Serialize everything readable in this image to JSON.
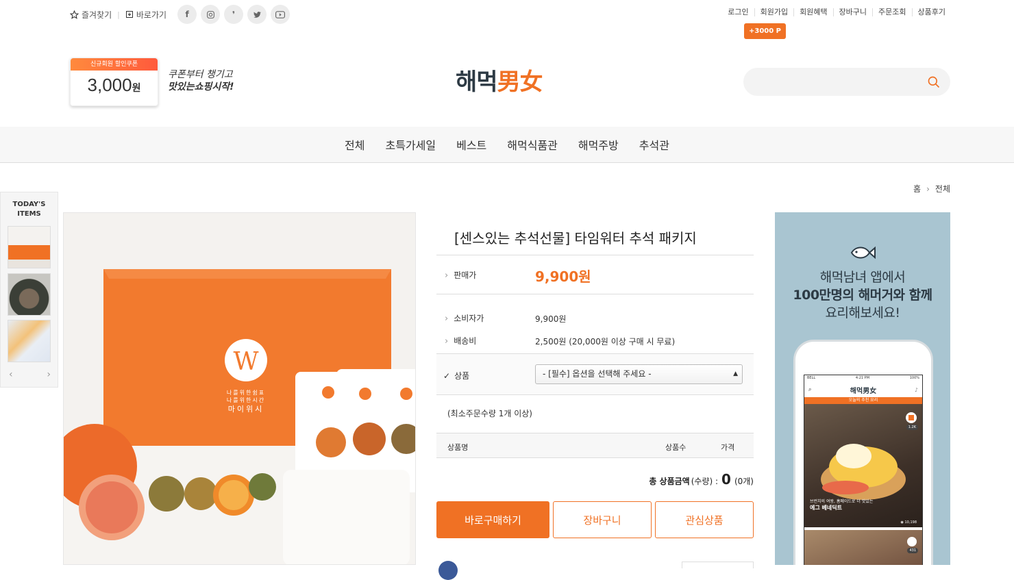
{
  "topbar": {
    "bookmark": "즐겨찾기",
    "shortcut": "바로가기",
    "social_icons": [
      "facebook-icon",
      "instagram-icon",
      "kakao-story-icon",
      "twitter-icon",
      "youtube-icon"
    ],
    "links": [
      "로그인",
      "회원가입",
      "회원혜택",
      "장바구니",
      "주문조회",
      "상품후기"
    ],
    "point_badge": "+3000 P"
  },
  "coupon": {
    "tag": "신규회원 할인쿠폰",
    "amount": "3,000",
    "unit": "원",
    "line1": "쿠폰부터 챙기고",
    "line2": "맛있는쇼핑시작!"
  },
  "logo": {
    "korean": "해먹",
    "hanja": "男女"
  },
  "search": {
    "placeholder": ""
  },
  "nav": [
    "전체",
    "초특가세일",
    "베스트",
    "해먹식품관",
    "해먹주방",
    "추석관"
  ],
  "breadcrumb": {
    "home": "홈",
    "current": "전체"
  },
  "today_items": {
    "title_line1": "TODAY'S",
    "title_line2": "ITEMS",
    "prev": "‹",
    "next": "›"
  },
  "product": {
    "title": "[센스있는 추석선물] 타임워터 추석 패키지",
    "sale_price_label": "판매가",
    "sale_price": "9,900원",
    "consumer_price_label": "소비자가",
    "consumer_price": "9,900원",
    "shipping_label": "배송비",
    "shipping": "2,500원 (20,000원 이상 구매 시 무료)",
    "option_label": "상품",
    "option_select": "- [필수] 옵션을 선택해 주세요 -",
    "min_order": "(최소주문수량 1개 이상)",
    "table_headers": [
      "상품명",
      "상품수",
      "가격"
    ],
    "total_label": "총 상품금액",
    "total_qty_label": "(수량) :",
    "total_amount": "0",
    "total_count": "(0개)",
    "buttons": {
      "buy": "바로구매하기",
      "cart": "장바구니",
      "wish": "관심상품"
    },
    "box_brand_line1": "나를위한쉼표",
    "box_brand_line2": "나를위한시간",
    "box_brand_name": "마이위시"
  },
  "banner": {
    "line1": "해먹남녀 앱에서",
    "line2": "100만명의 해머거와 함께",
    "line3": "요리해보세요!",
    "app_title": "해먹男女",
    "app_strip": "오늘의 추천 요리",
    "status_carrier": "BELL",
    "status_time": "4:21 PM",
    "status_battery": "100%",
    "recipe_caption": "브런치의 여왕, 홈메이드로 더 맛있는",
    "recipe_title": "에그 베네딕트",
    "recipe_views": "10,198",
    "recipe_badge": "1.2K",
    "recipe_badge2": "431"
  },
  "colors": {
    "accent": "#f07124",
    "logo_dark": "#2d3a44",
    "banner_bg": "#a9c5d1"
  }
}
